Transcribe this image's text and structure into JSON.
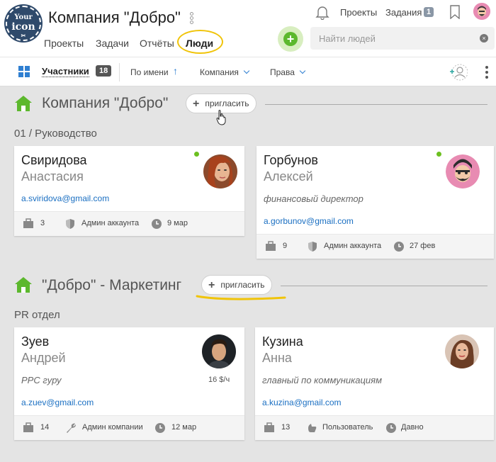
{
  "header": {
    "logo_lines": [
      "Your",
      "icon",
      "✂"
    ],
    "company_title": "Компания \"Добро\"",
    "nav_tabs": [
      "Проекты",
      "Задачи",
      "Отчёты",
      "Люди"
    ],
    "top_links": {
      "projects": "Проекты",
      "tasks": "Задания",
      "tasks_count": "1"
    },
    "search_placeholder": "Найти людей",
    "add_symbol": "+",
    "clear_symbol": "×"
  },
  "toolbar": {
    "participants_label": "Участники",
    "participants_count": "18",
    "sort_by": "По имени",
    "sort_arrow": "↑",
    "company_filter": "Компания",
    "rights_filter": "Права"
  },
  "sections": [
    {
      "title": "Компания \"Добро\"",
      "invite_label": "пригласить",
      "department": "01 / Руководство",
      "cards": [
        {
          "last_name": "Свиридова",
          "first_name": "Анастасия",
          "position": "",
          "email": "a.sviridova@gmail.com",
          "projects": "3",
          "role": "Админ аккаунта",
          "date": "9 мар",
          "online": true,
          "rate": ""
        },
        {
          "last_name": "Горбунов",
          "first_name": "Алексей",
          "position": "финансовый директор",
          "email": "a.gorbunov@gmail.com",
          "projects": "9",
          "role": "Админ аккаунта",
          "date": "27 фев",
          "online": true,
          "rate": ""
        }
      ]
    },
    {
      "title": "\"Добро\" - Маркетинг",
      "invite_label": "пригласить",
      "department": "PR отдел",
      "cards": [
        {
          "last_name": "Зуев",
          "first_name": "Андрей",
          "position": "PPC гуру",
          "email": "a.zuev@gmail.com",
          "projects": "14",
          "role": "Админ компании",
          "date": "12 мар",
          "online": false,
          "rate": "16 $/ч"
        },
        {
          "last_name": "Кузина",
          "first_name": "Анна",
          "position": "главный по коммуникациям",
          "email": "a.kuzina@gmail.com",
          "projects": "13",
          "role": "Пользователь",
          "date": "Давно",
          "online": false,
          "rate": ""
        }
      ]
    }
  ],
  "colors": {
    "accent_blue": "#2f7fd1",
    "accent_green": "#5cb82d",
    "highlight_yellow": "#f0c40a",
    "online_green": "#6cc020"
  },
  "icons": [
    "logo-icon",
    "bell-icon",
    "bookmark-icon",
    "grid-icon",
    "add-user-icon",
    "house-icon",
    "briefcase-icon",
    "shield-icon",
    "wrench-icon",
    "thumb-icon",
    "clock-icon",
    "cursor-hand-icon"
  ]
}
